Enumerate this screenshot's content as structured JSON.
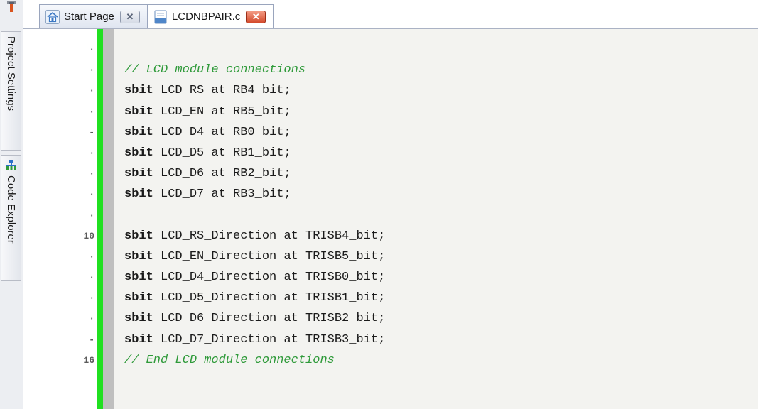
{
  "dock": {
    "panels": [
      {
        "label": "Project Settings",
        "icon": "wrench-icon"
      },
      {
        "label": "Code Explorer",
        "icon": "tree-icon"
      }
    ]
  },
  "tabs": [
    {
      "label": "Start Page",
      "icon": "home-icon",
      "active": false,
      "close": "✕"
    },
    {
      "label": "LCDNBPAIR.c",
      "icon": "file-icon",
      "active": true,
      "close": "✕"
    }
  ],
  "editor": {
    "lines": [
      {
        "num": "·",
        "text": ""
      },
      {
        "num": "·",
        "text": "// LCD module connections",
        "comment": true
      },
      {
        "num": "·",
        "kw": "sbit",
        "text": " LCD_RS at RB4_bit;"
      },
      {
        "num": "·",
        "kw": "sbit",
        "text": " LCD_EN at RB5_bit;"
      },
      {
        "num": "-",
        "kw": "sbit",
        "text": " LCD_D4 at RB0_bit;"
      },
      {
        "num": "·",
        "kw": "sbit",
        "text": " LCD_D5 at RB1_bit;"
      },
      {
        "num": "·",
        "kw": "sbit",
        "text": " LCD_D6 at RB2_bit;"
      },
      {
        "num": "·",
        "kw": "sbit",
        "text": " LCD_D7 at RB3_bit;"
      },
      {
        "num": "·",
        "text": ""
      },
      {
        "num": "10",
        "kw": "sbit",
        "text": " LCD_RS_Direction at TRISB4_bit;"
      },
      {
        "num": "·",
        "kw": "sbit",
        "text": " LCD_EN_Direction at TRISB5_bit;"
      },
      {
        "num": "·",
        "kw": "sbit",
        "text": " LCD_D4_Direction at TRISB0_bit;"
      },
      {
        "num": "·",
        "kw": "sbit",
        "text": " LCD_D5_Direction at TRISB1_bit;"
      },
      {
        "num": "·",
        "kw": "sbit",
        "text": " LCD_D6_Direction at TRISB2_bit;"
      },
      {
        "num": "-",
        "kw": "sbit",
        "text": " LCD_D7_Direction at TRISB3_bit;"
      },
      {
        "num": "16",
        "text": "// End LCD module connections",
        "comment": true
      }
    ]
  },
  "colors": {
    "change_bar": "#20e020",
    "comment": "#2f9a3a",
    "active_close": "#d34a2c"
  }
}
